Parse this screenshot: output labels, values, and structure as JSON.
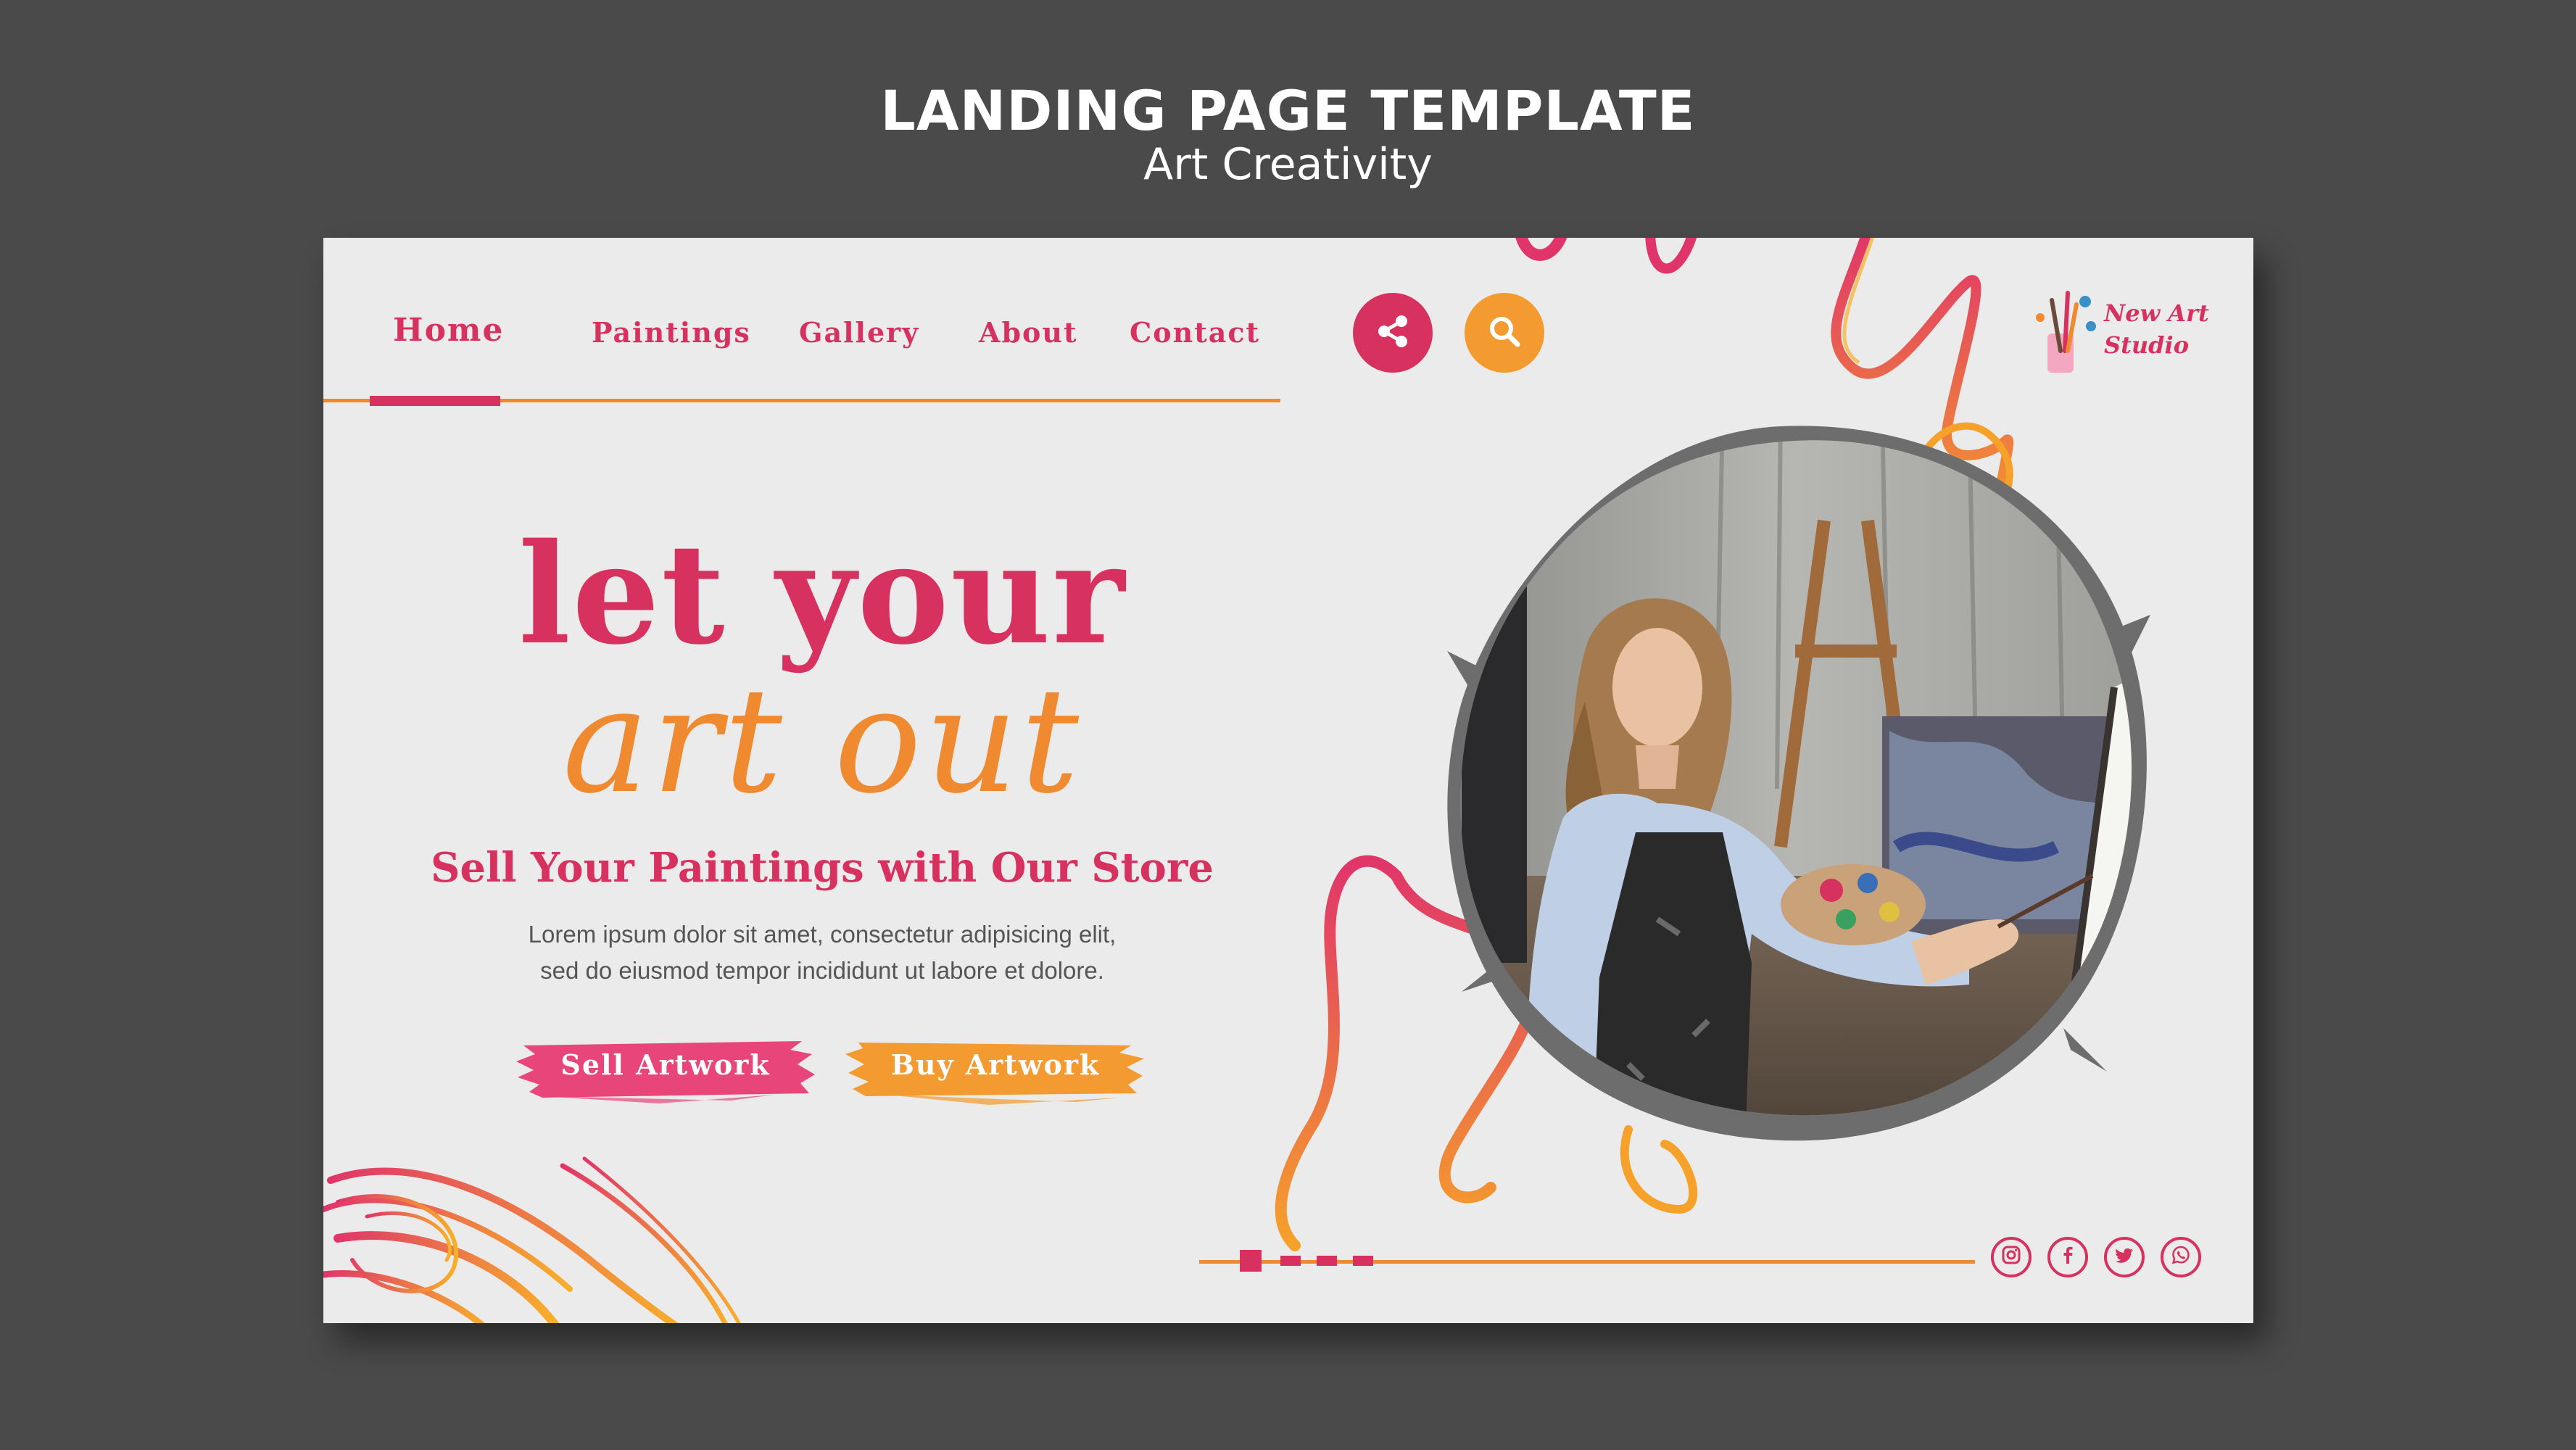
{
  "header": {
    "title": "LANDING PAGE TEMPLATE",
    "subtitle": "Art Creativity"
  },
  "nav": {
    "items": [
      {
        "label": "Home",
        "active": true
      },
      {
        "label": "Paintings"
      },
      {
        "label": "Gallery"
      },
      {
        "label": "About"
      },
      {
        "label": "Contact"
      }
    ],
    "share_icon": "share-icon",
    "search_icon": "search-icon"
  },
  "logo": {
    "line1": "New Art",
    "line2": "Studio",
    "icon": "paint-brushes-icon"
  },
  "hero": {
    "line1": "let your",
    "line2": "art out",
    "subheading": "Sell Your Paintings with Our Store",
    "body_line1": "Lorem ipsum dolor sit amet, consectetur adipisicing elit,",
    "body_line2": "sed do eiusmod tempor incididunt ut labore et dolore.",
    "sell_button": "Sell Artwork",
    "buy_button": "Buy Artwork"
  },
  "pagination": {
    "active_index": 0,
    "count": 4
  },
  "social": {
    "icons": [
      "instagram-icon",
      "facebook-icon",
      "twitter-icon",
      "whatsapp-icon"
    ]
  },
  "colors": {
    "background": "#4a4a4a",
    "card": "#ebebeb",
    "pink": "#d6315f",
    "orange": "#f08a30"
  }
}
